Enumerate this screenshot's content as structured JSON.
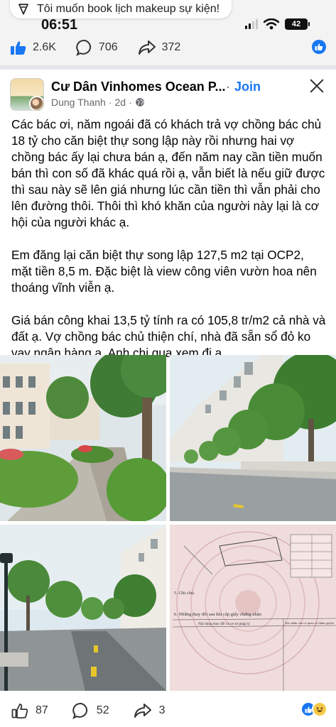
{
  "notification": {
    "text": "Tôi muốn book lịch makeup sự kiện!"
  },
  "status_bar": {
    "time": "06:51",
    "battery": "42"
  },
  "prev_post_stats": {
    "likes": "2.6K",
    "comments": "706",
    "shares": "372"
  },
  "post": {
    "group_name": "Cư Dân Vinhomes Ocean P...",
    "join_separator": "·",
    "join_label": "Join",
    "author": "Dung Thanh",
    "separator": "·",
    "time": "2d",
    "separator2": "·",
    "paragraphs": [
      "Các bác ơi, năm ngoái đã có khách trả vợ chồng bác chủ 18 tỷ cho căn biệt thự song lập này rồi nhưng hai vợ chồng bác ấy lại chưa bán ạ, đến năm nay cần tiền muốn bán thì con số đã khác quá rồi ạ, vẫn biết là nếu giữ được thì sau này sẽ lên giá nhưng lúc cần tiền thì vẫn phải cho lên đường thôi. Thôi thì khó khăn của người này lại là cơ hội của người khác ạ.",
      "Em đăng lại căn biệt thự song lập 127,5 m2 tại OCP2, mặt tiền 8,5 m. Đặc biệt là view công viên vườn hoa nên thoáng vĩnh viễn ạ.",
      "Giá bán công khai 13,5 tỷ tính ra có 105,8 tr/m2 cả nhà và đất ạ. Vợ chồng bác chủ thiện chí, nhà đã sẵn sổ đỏ ko vay ngân hàng ạ. Anh chị qua xem đi ạ."
    ],
    "certificate": {
      "section5": "5. Ghi chú:",
      "section6": "6. Những thay đổi sau khi cấp giấy chứng nhận",
      "col1": "Nội dung thay đổi và cơ sở pháp lý",
      "col2": "Xác nhận của cơ quan có thẩm quyền"
    },
    "stats": {
      "likes": "87",
      "comments": "52",
      "shares": "3"
    }
  },
  "colors": {
    "accent": "#1877f2",
    "text": "#050505",
    "secondary": "#65676b"
  },
  "icons": [
    "megaphone-icon",
    "signal-icon",
    "wifi-icon",
    "battery-icon",
    "like-icon",
    "comment-icon",
    "share-icon",
    "globe-icon",
    "close-icon",
    "haha-icon"
  ]
}
